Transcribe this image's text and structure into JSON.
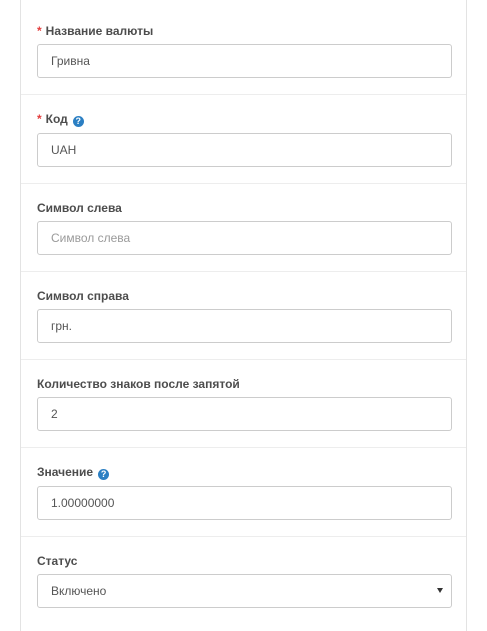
{
  "fields": {
    "name": {
      "label": "Название валюты",
      "required_mark": "*",
      "value": "Гривна"
    },
    "code": {
      "label": "Код",
      "required_mark": "*",
      "help_glyph": "?",
      "value": "UAH"
    },
    "symbol_left": {
      "label": "Символ слева",
      "placeholder": "Символ слева",
      "value": ""
    },
    "symbol_right": {
      "label": "Символ справа",
      "value": "грн."
    },
    "decimal_places": {
      "label": "Количество знаков после запятой",
      "value": "2"
    },
    "value": {
      "label": "Значение",
      "help_glyph": "?",
      "value": "1.00000000"
    },
    "status": {
      "label": "Статус",
      "selected": "Включено"
    }
  },
  "colors": {
    "required": "#e33d3d",
    "help_icon": "#2b7fc3",
    "border": "#cccccc",
    "label": "#4d4d4d"
  }
}
